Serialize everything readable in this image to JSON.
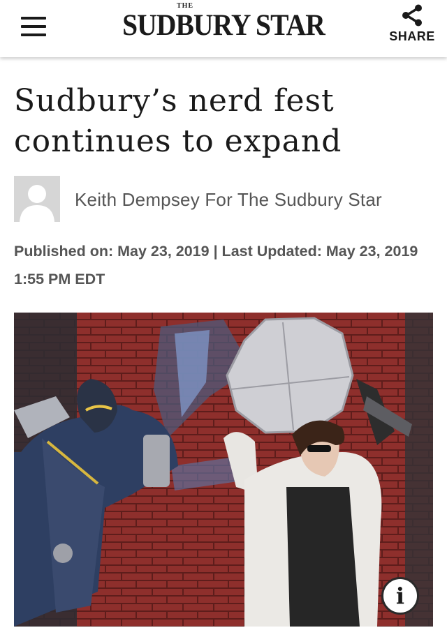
{
  "header": {
    "logo_small": "THE",
    "logo_main": "SUDBURY STAR",
    "share_label": "SHARE",
    "menu_icon": "hamburger-menu-icon",
    "share_icon": "share-icon"
  },
  "article": {
    "headline": "Sudbury’s nerd fest continues to expand",
    "author": "Keith Dempsey For The Sudbury Star",
    "published_info": "Published on: May 23, 2019 | Last Updated: May 23, 2019 1:55 PM EDT",
    "photo": {
      "description_icon": "info-icon",
      "info_glyph": "i"
    }
  },
  "colors": {
    "text_dark": "#1a1a1a",
    "text_muted": "#555555",
    "avatar_bg": "#d6d6d6",
    "header_bg": "#ffffff"
  }
}
